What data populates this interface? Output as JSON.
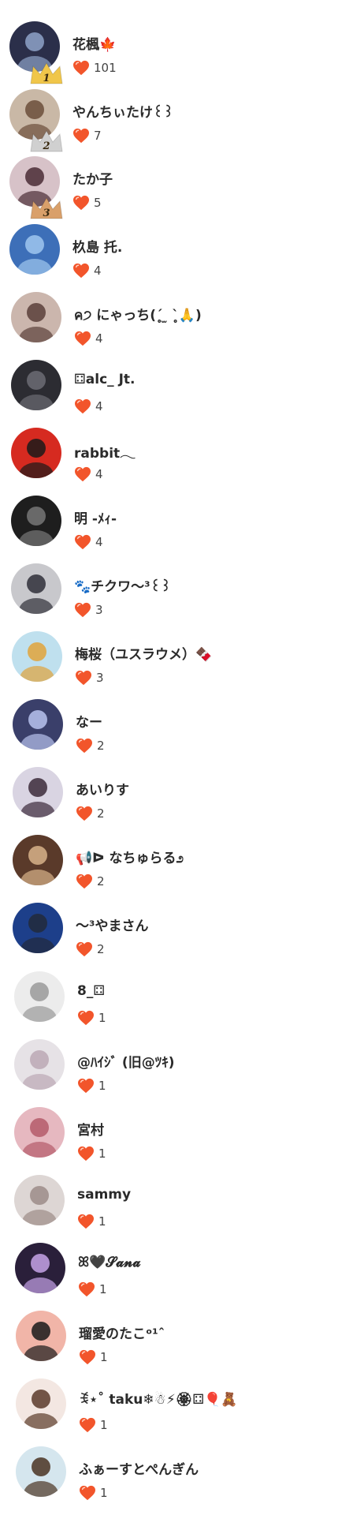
{
  "users": [
    {
      "name": "花楓🍁",
      "likes": "101",
      "rank": "1",
      "color": "#2b2f4a",
      "accent": "#8ea2c8"
    },
    {
      "name": "やんちぃたけ꒰꒱",
      "likes": "7",
      "rank": "2",
      "color": "#c9b8a6",
      "accent": "#6b4d3a"
    },
    {
      "name": "たか子",
      "likes": "5",
      "rank": "3",
      "color": "#d7c2c8",
      "accent": "#4a2c35"
    },
    {
      "name": "杦島 托.",
      "likes": "4",
      "rank": "",
      "color": "#3d6fb8",
      "accent": "#9fc7ee"
    },
    {
      "name": "ค੭ にゃっち(ˊ̥̥ ̫ ˋ̥̥🙏)",
      "likes": "4",
      "rank": "",
      "color": "#cbb6ad",
      "accent": "#5a4039"
    },
    {
      "name": "⚃alc_ Jt.",
      "likes": "4",
      "rank": "",
      "color": "#2c2c32",
      "accent": "#6c6c74"
    },
    {
      "name": "rabbit𓂃",
      "likes": "4",
      "rank": "",
      "color": "#d62a20",
      "accent": "#1a1a1a"
    },
    {
      "name": "明 -ﾒｨ-",
      "likes": "4",
      "rank": "",
      "color": "#1e1e1e",
      "accent": "#777777"
    },
    {
      "name": "🐾チクワ〜³꒰꒱",
      "likes": "3",
      "rank": "",
      "color": "#c8c8cc",
      "accent": "#2f2f38"
    },
    {
      "name": "梅桜（ユスラウメ）🍫",
      "likes": "3",
      "rank": "",
      "color": "#bfe0ee",
      "accent": "#e0a33b"
    },
    {
      "name": "なー",
      "likes": "2",
      "rank": "",
      "color": "#3a3f6a",
      "accent": "#b8c3ee"
    },
    {
      "name": "あいりす",
      "likes": "2",
      "rank": "",
      "color": "#d9d4e2",
      "accent": "#3b2a3a"
    },
    {
      "name": "📢ᐅ なちゅらる೨",
      "likes": "2",
      "rank": "",
      "color": "#5a3a2a",
      "accent": "#d8b38a"
    },
    {
      "name": "〜³やまさん",
      "likes": "2",
      "rank": "",
      "color": "#1d3f8a",
      "accent": "#222a3a"
    },
    {
      "name": "8_⚃",
      "likes": "1",
      "rank": "",
      "color": "#ececec",
      "accent": "#9a9a9a"
    },
    {
      "name": "@ﾊｲｼﾞ (旧@ﾂｷ)",
      "likes": "1",
      "rank": "",
      "color": "#e6e2e6",
      "accent": "#bba8b4"
    },
    {
      "name": "宮村",
      "likes": "1",
      "rank": "",
      "color": "#e6b8c0",
      "accent": "#b45a6a"
    },
    {
      "name": "sammy",
      "likes": "1",
      "rank": "",
      "color": "#ddd6d4",
      "accent": "#9c8c88"
    },
    {
      "name": "ꕤ🖤𝓢𝓪𝓷𝓪",
      "likes": "1",
      "rank": "",
      "color": "#2a1f3a",
      "accent": "#c6a3e8"
    },
    {
      "name": "瑠愛のたこᵒ¹ˆ",
      "likes": "1",
      "rank": "",
      "color": "#f1b5a8",
      "accent": "#1a1a1a"
    },
    {
      "name": "ꉂ⋆˚ taku❄☃⚡🏵⚃🎈🧸",
      "likes": "1",
      "rank": "",
      "color": "#f3e7e2",
      "accent": "#5a3a2a"
    },
    {
      "name": "ふぁーすとぺんぎん",
      "likes": "1",
      "rank": "",
      "color": "#d5e6ee",
      "accent": "#4a3322"
    }
  ],
  "colors": {
    "heart": "#f2552b",
    "heart_shadow": "#d9411d",
    "gold": "#f0c64a",
    "silver": "#d0d0d0",
    "bronze": "#d9a06a"
  }
}
